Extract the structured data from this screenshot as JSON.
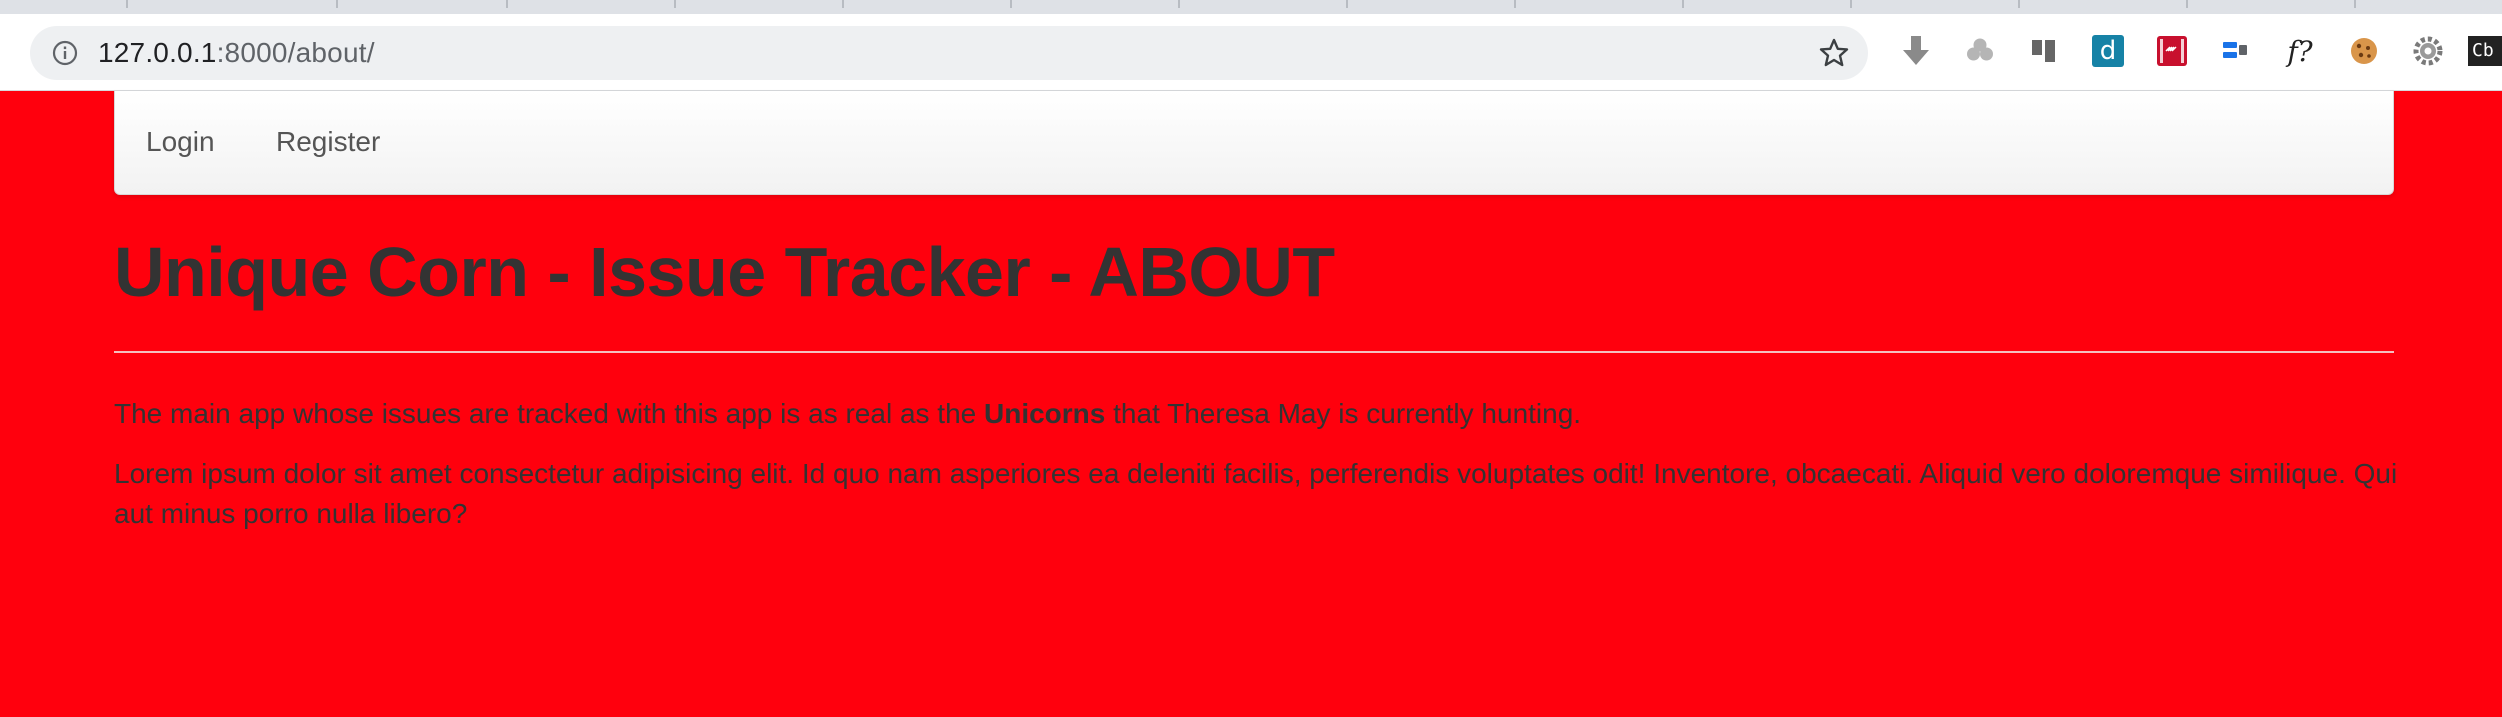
{
  "browser": {
    "url_host": "127.0.0.1",
    "url_path": ":8000/about/",
    "extensions": [
      "download-icon",
      "clover-icon",
      "panel-icon",
      "d-extension-icon",
      "film-extension-icon",
      "cast-icon",
      "function-icon",
      "cookie-icon",
      "gear-icon",
      "cb-icon"
    ],
    "ext_labels": {
      "d": "d",
      "f": "f?",
      "cb": "Cb"
    }
  },
  "nav": {
    "login": "Login",
    "register": "Register"
  },
  "page": {
    "title": "Unique Corn - Issue Tracker - ABOUT",
    "para1_before": "The main app whose issues are tracked with this app is as real as the ",
    "para1_bold": "Unicorns",
    "para1_after": " that Theresa May is currently hunting.",
    "para2": "Lorem ipsum dolor sit amet consectetur adipisicing elit. Id quo nam asperiores ea deleniti facilis, perferendis voluptates odit! Inventore, obcaecati. Aliquid vero doloremque similique. Qui aut minus porro nulla libero?"
  },
  "colors": {
    "page_background": "#ff000d",
    "heading_text": "#333333",
    "navbar_background": "#f8f8f8"
  }
}
